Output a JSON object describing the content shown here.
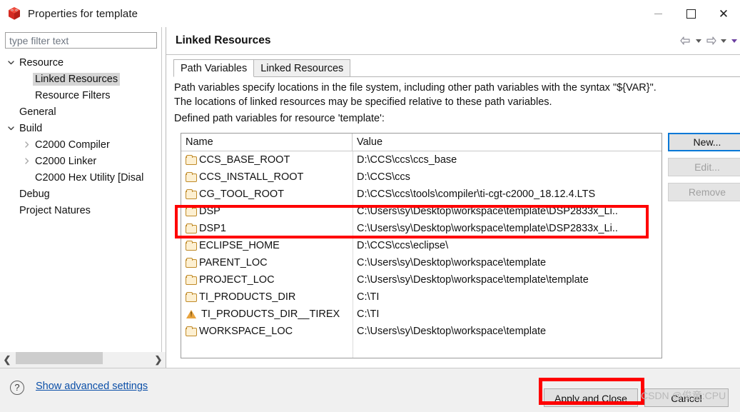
{
  "window": {
    "title": "Properties for template",
    "icon": "ccs-cube-icon",
    "controls": {
      "minimize": "minimize-icon",
      "maximize": "maximize-icon",
      "close": "close-icon"
    }
  },
  "filter": {
    "placeholder": "type filter text",
    "value": ""
  },
  "tree": [
    {
      "label": "Resource",
      "indent": 0,
      "twisty": "expanded",
      "selected": false
    },
    {
      "label": "Linked Resources",
      "indent": 1,
      "twisty": "none",
      "selected": true
    },
    {
      "label": "Resource Filters",
      "indent": 1,
      "twisty": "none",
      "selected": false
    },
    {
      "label": "General",
      "indent": 0,
      "twisty": "none",
      "selected": false
    },
    {
      "label": "Build",
      "indent": 0,
      "twisty": "expanded",
      "selected": false
    },
    {
      "label": "C2000 Compiler",
      "indent": 1,
      "twisty": "collapsed",
      "selected": false
    },
    {
      "label": "C2000 Linker",
      "indent": 1,
      "twisty": "collapsed",
      "selected": false
    },
    {
      "label": "C2000 Hex Utility  [Disal",
      "indent": 1,
      "twisty": "none",
      "selected": false
    },
    {
      "label": "Debug",
      "indent": 0,
      "twisty": "none",
      "selected": false
    },
    {
      "label": "Project Natures",
      "indent": 0,
      "twisty": "none",
      "selected": false
    }
  ],
  "page": {
    "title": "Linked Resources",
    "nav": {
      "back": "back-arrow-icon",
      "forward": "forward-arrow-icon"
    },
    "tabs": [
      {
        "label": "Path Variables",
        "active": true
      },
      {
        "label": "Linked Resources",
        "active": false
      }
    ],
    "description_line1": "Path variables specify locations in the file system, including other path variables with the syntax \"${VAR}\".",
    "description_line2": "The locations of linked resources may be specified relative to these path variables.",
    "description_line3": "Defined path variables for resource 'template':"
  },
  "table": {
    "columns": [
      "Name",
      "Value"
    ],
    "rows": [
      {
        "icon": "folder-icon",
        "name": "CCS_BASE_ROOT",
        "value": "D:\\CCS\\ccs\\ccs_base",
        "highlighted": false
      },
      {
        "icon": "folder-icon",
        "name": "CCS_INSTALL_ROOT",
        "value": "D:\\CCS\\ccs",
        "highlighted": false
      },
      {
        "icon": "folder-icon",
        "name": "CG_TOOL_ROOT",
        "value": "D:\\CCS\\ccs\\tools\\compiler\\ti-cgt-c2000_18.12.4.LTS",
        "highlighted": false
      },
      {
        "icon": "folder-icon",
        "name": "DSP",
        "value": "C:\\Users\\sy\\Desktop\\workspace\\template\\DSP2833x_Li..",
        "highlighted": true
      },
      {
        "icon": "folder-icon",
        "name": "DSP1",
        "value": "C:\\Users\\sy\\Desktop\\workspace\\template\\DSP2833x_Li..",
        "highlighted": true
      },
      {
        "icon": "folder-icon",
        "name": "ECLIPSE_HOME",
        "value": "D:\\CCS\\ccs\\eclipse\\",
        "highlighted": false
      },
      {
        "icon": "folder-icon",
        "name": "PARENT_LOC",
        "value": "C:\\Users\\sy\\Desktop\\workspace\\template",
        "highlighted": false
      },
      {
        "icon": "folder-icon",
        "name": "PROJECT_LOC",
        "value": "C:\\Users\\sy\\Desktop\\workspace\\template\\template",
        "highlighted": false
      },
      {
        "icon": "folder-icon",
        "name": "TI_PRODUCTS_DIR",
        "value": "C:\\TI",
        "highlighted": false
      },
      {
        "icon": "warning-icon",
        "name": "TI_PRODUCTS_DIR__TIREX",
        "value": "C:\\TI",
        "highlighted": false
      },
      {
        "icon": "folder-icon",
        "name": "WORKSPACE_LOC",
        "value": "C:\\Users\\sy\\Desktop\\workspace\\template",
        "highlighted": false
      }
    ]
  },
  "side_buttons": [
    {
      "label": "New...",
      "state": "focused"
    },
    {
      "label": "Edit...",
      "state": "disabled"
    },
    {
      "label": "Remove",
      "state": "disabled"
    }
  ],
  "footer": {
    "help_icon": "question-mark-icon",
    "advanced_link": "Show advanced settings",
    "apply_label": "Apply and Close",
    "cancel_label": "Cancel"
  },
  "watermark": "CSDN @俊童:CPU",
  "colors": {
    "accent_focus": "#0078d7",
    "annotation_red": "#ff0000",
    "link_blue": "#0b4fa8",
    "folder_gold": "#c08a28",
    "warning_amber": "#e8a33d",
    "selection_gray": "#d5d5d5"
  }
}
